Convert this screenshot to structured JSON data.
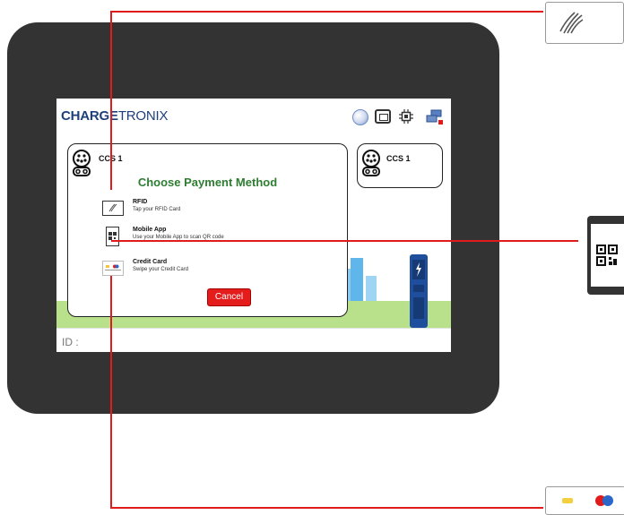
{
  "brand": {
    "part1": "CHARGE",
    "part2": "TRONIX"
  },
  "status_icons": [
    "connection-status-icon",
    "card-reader-icon",
    "chip-icon",
    "network-icon"
  ],
  "connectors": {
    "left": {
      "label": "CCS 1"
    },
    "right": {
      "label": "CCS 1"
    }
  },
  "modal": {
    "title": "Choose Payment Method",
    "options": [
      {
        "title": "RFID",
        "subtitle": "Tap your RFID Card",
        "icon": "rfid-card-icon"
      },
      {
        "title": "Mobile App",
        "subtitle": "Use your Mobile App to scan QR code",
        "icon": "qr-code-icon"
      },
      {
        "title": "Credit Card",
        "subtitle": "Swipe your Credit Card",
        "icon": "credit-card-icon"
      }
    ],
    "cancel_label": "Cancel"
  },
  "id_label": "ID :",
  "callouts": [
    "rfid-callout",
    "mobile-app-callout",
    "credit-card-callout"
  ],
  "colors": {
    "accent_red": "#e01b1b",
    "title_green": "#2e7d32",
    "brand_blue": "#1f3f7a",
    "bezel": "#333333"
  }
}
